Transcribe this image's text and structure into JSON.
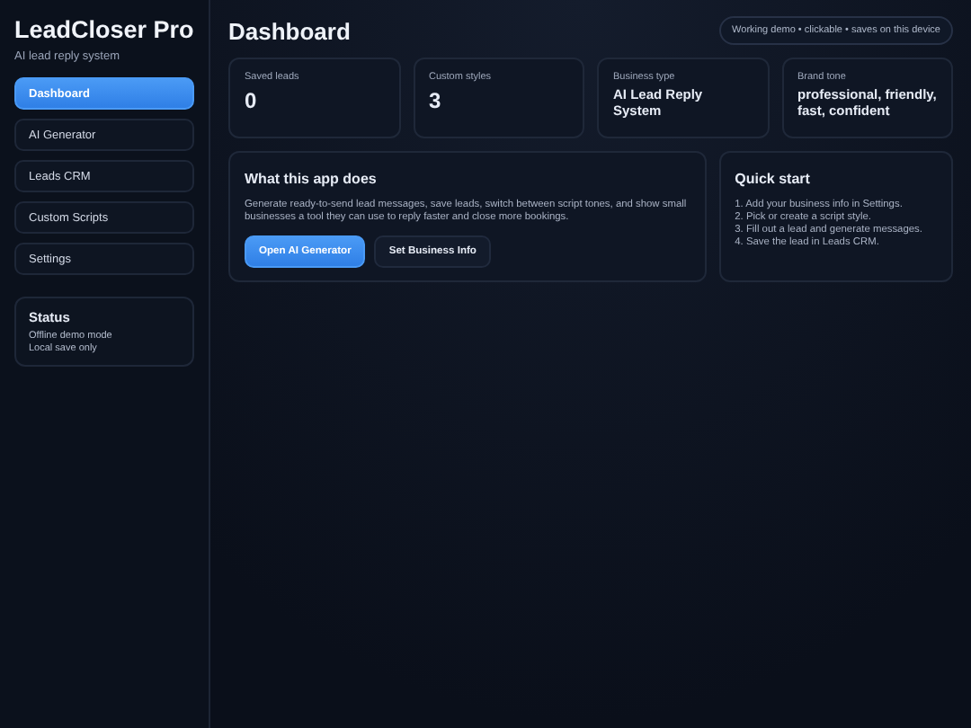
{
  "sidebar": {
    "app_name": "LeadCloser Pro",
    "tagline": "AI lead reply system",
    "nav": [
      {
        "label": "Dashboard",
        "selected": true
      },
      {
        "label": "AI Generator",
        "selected": false
      },
      {
        "label": "Leads CRM",
        "selected": false
      },
      {
        "label": "Custom Scripts",
        "selected": false
      },
      {
        "label": "Settings",
        "selected": false
      }
    ],
    "status": {
      "title": "Status",
      "lines": [
        "Offline demo mode",
        "Local save only"
      ]
    }
  },
  "header": {
    "title": "Dashboard",
    "badge": "Working demo • clickable • saves on this device"
  },
  "stats": [
    {
      "label": "Saved leads",
      "value": "0",
      "kind": "number"
    },
    {
      "label": "Custom styles",
      "value": "3",
      "kind": "number"
    },
    {
      "label": "Business type",
      "value": "AI Lead Reply System",
      "kind": "text"
    },
    {
      "label": "Brand tone",
      "value": "professional, friendly, fast, confident",
      "kind": "text"
    }
  ],
  "about": {
    "title": "What this app does",
    "text": "Generate ready-to-send lead messages, save leads, switch between script tones, and show small businesses a tool they can use to reply faster and close more bookings.",
    "buttons": [
      {
        "label": "Open AI Generator",
        "kind": "primary"
      },
      {
        "label": "Set Business Info",
        "kind": "secondary"
      }
    ]
  },
  "quick_start": {
    "title": "Quick start",
    "steps": [
      "1. Add your business info in Settings.",
      "2. Pick or create a script style.",
      "3. Fill out a lead and generate messages.",
      "4. Save the lead in Leads CRM."
    ]
  }
}
